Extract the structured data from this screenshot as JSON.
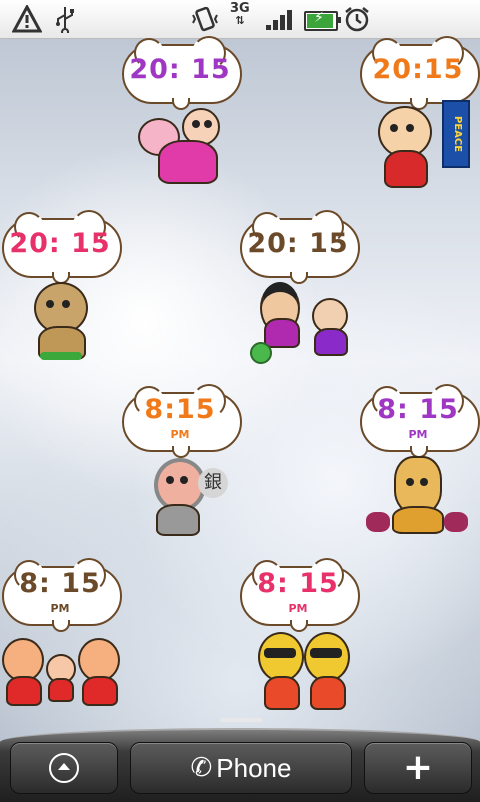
{
  "status_bar": {
    "network_type": "3G",
    "warning_icon": "warning-triangle-icon",
    "usb_icon": "usb-icon",
    "vibrate_icon": "vibrate-icon",
    "signal_icon": "signal-bars-icon",
    "battery_icon": "battery-charging-icon",
    "alarm_icon": "alarm-clock-icon"
  },
  "widgets": [
    {
      "time": "20: 15",
      "ampm": "",
      "color": "#a037c4"
    },
    {
      "time": "20:15",
      "ampm": "",
      "color": "#f07a1a"
    },
    {
      "time": "20: 15",
      "ampm": "",
      "color": "#e8306a"
    },
    {
      "time": "20: 15",
      "ampm": "",
      "color": "#6b4a2a"
    },
    {
      "time": "8:15",
      "ampm": "PM",
      "color": "#f07a1a"
    },
    {
      "time": "8: 15",
      "ampm": "PM",
      "color": "#a037c4"
    },
    {
      "time": "8: 15",
      "ampm": "PM",
      "color": "#6b4a2a"
    },
    {
      "time": "8: 15",
      "ampm": "PM",
      "color": "#e8306a"
    }
  ],
  "peace_banner": "PEACE",
  "kanji_badge": "銀",
  "dock": {
    "phone_label": "Phone",
    "launcher_icon": "arrow-up-circle-icon",
    "phone_icon": "phone-handset-icon",
    "add_icon": "plus-icon"
  }
}
